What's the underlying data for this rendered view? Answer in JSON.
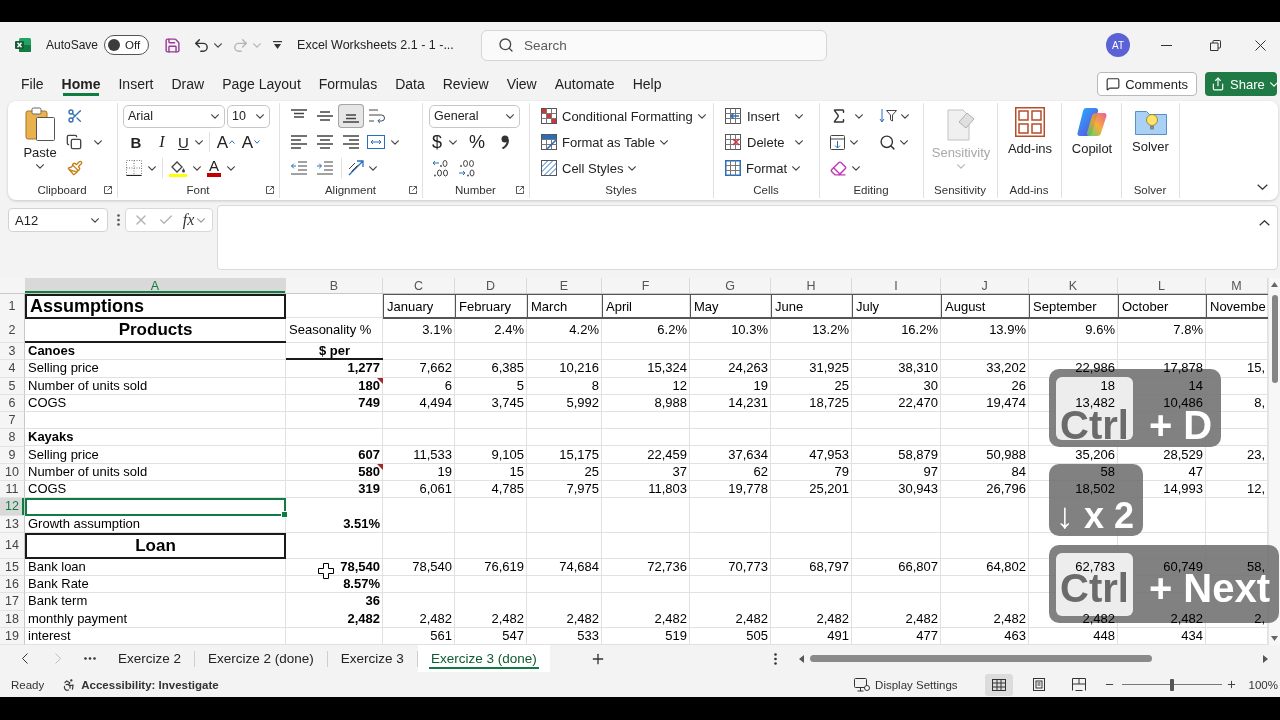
{
  "title_bar": {
    "autosave_label": "AutoSave",
    "autosave": {
      "label": "Off",
      "on": false
    },
    "document_title": "Excel Worksheets 2.1 - 1 -...",
    "search": {
      "placeholder": "Search"
    },
    "user_initials": "AT"
  },
  "menu": {
    "tabs": [
      {
        "label": "File",
        "selected": false
      },
      {
        "label": "Home",
        "selected": true
      },
      {
        "label": "Insert",
        "selected": false
      },
      {
        "label": "Draw",
        "selected": false
      },
      {
        "label": "Page Layout",
        "selected": false
      },
      {
        "label": "Formulas",
        "selected": false
      },
      {
        "label": "Data",
        "selected": false
      },
      {
        "label": "Review",
        "selected": false
      },
      {
        "label": "View",
        "selected": false
      },
      {
        "label": "Automate",
        "selected": false
      },
      {
        "label": "Help",
        "selected": false
      }
    ],
    "comments": "Comments",
    "share": "Share"
  },
  "ribbon": {
    "clipboard": {
      "label": "Clipboard",
      "paste": "Paste"
    },
    "font": {
      "label": "Font",
      "font_name": "Arial",
      "font_size": "10",
      "bold": "B",
      "italic": "I",
      "underline": "U",
      "grow_font": "A",
      "shrink_font": "A",
      "font_color": "A"
    },
    "alignment": {
      "label": "Alignment",
      "vertical": [
        {
          "selected": false
        },
        {
          "selected": false
        },
        {
          "selected": true
        }
      ]
    },
    "number": {
      "label": "Number",
      "format": "General",
      "currency": "$",
      "percent": "%"
    },
    "styles": {
      "label": "Styles",
      "items": [
        "Conditional Formatting",
        "Format as Table",
        "Cell Styles"
      ]
    },
    "cells": {
      "label": "Cells",
      "items": [
        "Insert",
        "Delete",
        "Format"
      ]
    },
    "editing": {
      "label": "Editing"
    },
    "sensitivity": {
      "label": "Sensitivity",
      "button": "Sensitivity",
      "disabled": true
    },
    "add_ins": {
      "label": "Add-ins",
      "button": "Add-ins"
    },
    "copilot": {
      "button": "Copilot"
    },
    "solver": {
      "label": "Solver",
      "button": "Solver"
    }
  },
  "formula_bar": {
    "name_box": "A12",
    "function_label": "fx"
  },
  "sheet": {
    "columns": [
      {
        "label": "A",
        "selected": true
      },
      {
        "label": "B",
        "selected": false
      },
      {
        "label": "C",
        "selected": false
      },
      {
        "label": "D",
        "selected": false
      },
      {
        "label": "E",
        "selected": false
      },
      {
        "label": "F",
        "selected": false
      },
      {
        "label": "G",
        "selected": false
      },
      {
        "label": "H",
        "selected": false
      },
      {
        "label": "I",
        "selected": false
      },
      {
        "label": "J",
        "selected": false
      },
      {
        "label": "K",
        "selected": false
      },
      {
        "label": "L",
        "selected": false
      },
      {
        "label": "M",
        "selected": false
      }
    ],
    "rows": [
      {
        "number": "1",
        "kind": "title",
        "selected": false,
        "comment": false,
        "cells": [
          "Assumptions",
          null,
          "January",
          "February",
          "March",
          "April",
          "May",
          "June",
          "July",
          "August",
          "September",
          "October",
          "Novembe"
        ]
      },
      {
        "number": "2",
        "kind": "heading",
        "selected": false,
        "comment": false,
        "cells": [
          "Products",
          "Seasonality %",
          "3.1%",
          "2.4%",
          "4.2%",
          "6.2%",
          "10.3%",
          "13.2%",
          "16.2%",
          "13.9%",
          "9.6%",
          "7.8%"
        ]
      },
      {
        "number": "3",
        "kind": "section",
        "selected": false,
        "comment": false,
        "cells": [
          "Canoes",
          "$ per"
        ]
      },
      {
        "number": "4",
        "kind": "data",
        "selected": false,
        "comment": false,
        "cells": [
          "Selling price",
          "1,277",
          "7,662",
          "6,385",
          "10,216",
          "15,324",
          "24,263",
          "31,925",
          "38,310",
          "33,202",
          "22,986",
          "17,878",
          "15,"
        ]
      },
      {
        "number": "5",
        "kind": "data",
        "selected": false,
        "comment": true,
        "cells": [
          "Number of units sold",
          "180",
          "6",
          "5",
          "8",
          "12",
          "19",
          "25",
          "30",
          "26",
          "18",
          "14"
        ]
      },
      {
        "number": "6",
        "kind": "data",
        "selected": false,
        "comment": false,
        "cells": [
          "COGS",
          "749",
          "4,494",
          "3,745",
          "5,992",
          "8,988",
          "14,231",
          "18,725",
          "22,470",
          "19,474",
          "13,482",
          "10,486",
          "8,"
        ]
      },
      {
        "number": "7",
        "kind": "blank",
        "selected": false,
        "comment": false
      },
      {
        "number": "8",
        "kind": "section",
        "selected": false,
        "comment": false,
        "cells": [
          "Kayaks"
        ]
      },
      {
        "number": "9",
        "kind": "data",
        "selected": false,
        "comment": false,
        "cells": [
          "Selling price",
          "607",
          "11,533",
          "9,105",
          "15,175",
          "22,459",
          "37,634",
          "47,953",
          "58,879",
          "50,988",
          "35,206",
          "28,529",
          "23,"
        ]
      },
      {
        "number": "10",
        "kind": "data",
        "selected": false,
        "comment": true,
        "cells": [
          "Number of units sold",
          "580",
          "19",
          "15",
          "25",
          "37",
          "62",
          "79",
          "97",
          "84",
          "58",
          "47"
        ]
      },
      {
        "number": "11",
        "kind": "data",
        "selected": false,
        "comment": false,
        "cells": [
          "COGS",
          "319",
          "6,061",
          "4,785",
          "7,975",
          "11,803",
          "19,778",
          "25,201",
          "30,943",
          "26,796",
          "18,502",
          "14,993",
          "12,"
        ]
      },
      {
        "number": "12",
        "kind": "blank",
        "selected": true,
        "comment": false
      },
      {
        "number": "13",
        "kind": "data",
        "selected": false,
        "comment": false,
        "cells": [
          "Growth assumption",
          "3.51%"
        ]
      },
      {
        "number": "14",
        "kind": "box_heading",
        "selected": false,
        "comment": false,
        "cells": [
          "Loan"
        ]
      },
      {
        "number": "15",
        "kind": "data",
        "selected": false,
        "comment": false,
        "cells": [
          "Bank loan",
          "78,540",
          "78,540",
          "76,619",
          "74,684",
          "72,736",
          "70,773",
          "68,797",
          "66,807",
          "64,802",
          "62,783",
          "60,749",
          "58,"
        ]
      },
      {
        "number": "16",
        "kind": "data",
        "selected": false,
        "comment": false,
        "cells": [
          "Bank Rate",
          "8.57%"
        ]
      },
      {
        "number": "17",
        "kind": "data",
        "selected": false,
        "comment": false,
        "cells": [
          "Bank term",
          "36"
        ]
      },
      {
        "number": "18",
        "kind": "data",
        "selected": false,
        "comment": false,
        "cells": [
          "monthly payment",
          "2,482",
          "2,482",
          "2,482",
          "2,482",
          "2,482",
          "2,482",
          "2,482",
          "2,482",
          "2,482",
          "2,482",
          "2,482",
          "2,"
        ]
      },
      {
        "number": "19",
        "kind": "data",
        "selected": false,
        "comment": false,
        "cells": [
          "interest",
          null,
          "561",
          "547",
          "533",
          "519",
          "505",
          "491",
          "477",
          "463",
          "448",
          "434"
        ]
      }
    ]
  },
  "key_overlay": [
    {
      "kind": "combo",
      "key": "Ctrl",
      "text": "+ D"
    },
    {
      "kind": "plain",
      "text": "↓ x 2"
    },
    {
      "kind": "combo",
      "key": "Ctrl",
      "text": "+ Next"
    }
  ],
  "sheet_tabs": {
    "tabs": [
      {
        "label": "Exercize 2",
        "selected": false
      },
      {
        "label": "Exercize 2 (done)",
        "selected": false
      },
      {
        "label": "Exercize 3",
        "selected": false
      },
      {
        "label": "Exercize 3 (done)",
        "selected": true
      }
    ]
  },
  "status_bar": {
    "status": "Ready",
    "accessibility": "Accessibility: Investigate",
    "display_settings": "Display Settings",
    "views": [
      {
        "selected": true
      },
      {
        "selected": false
      },
      {
        "selected": false
      }
    ],
    "zoom": {
      "level": 0.5,
      "reading": "100%"
    }
  }
}
